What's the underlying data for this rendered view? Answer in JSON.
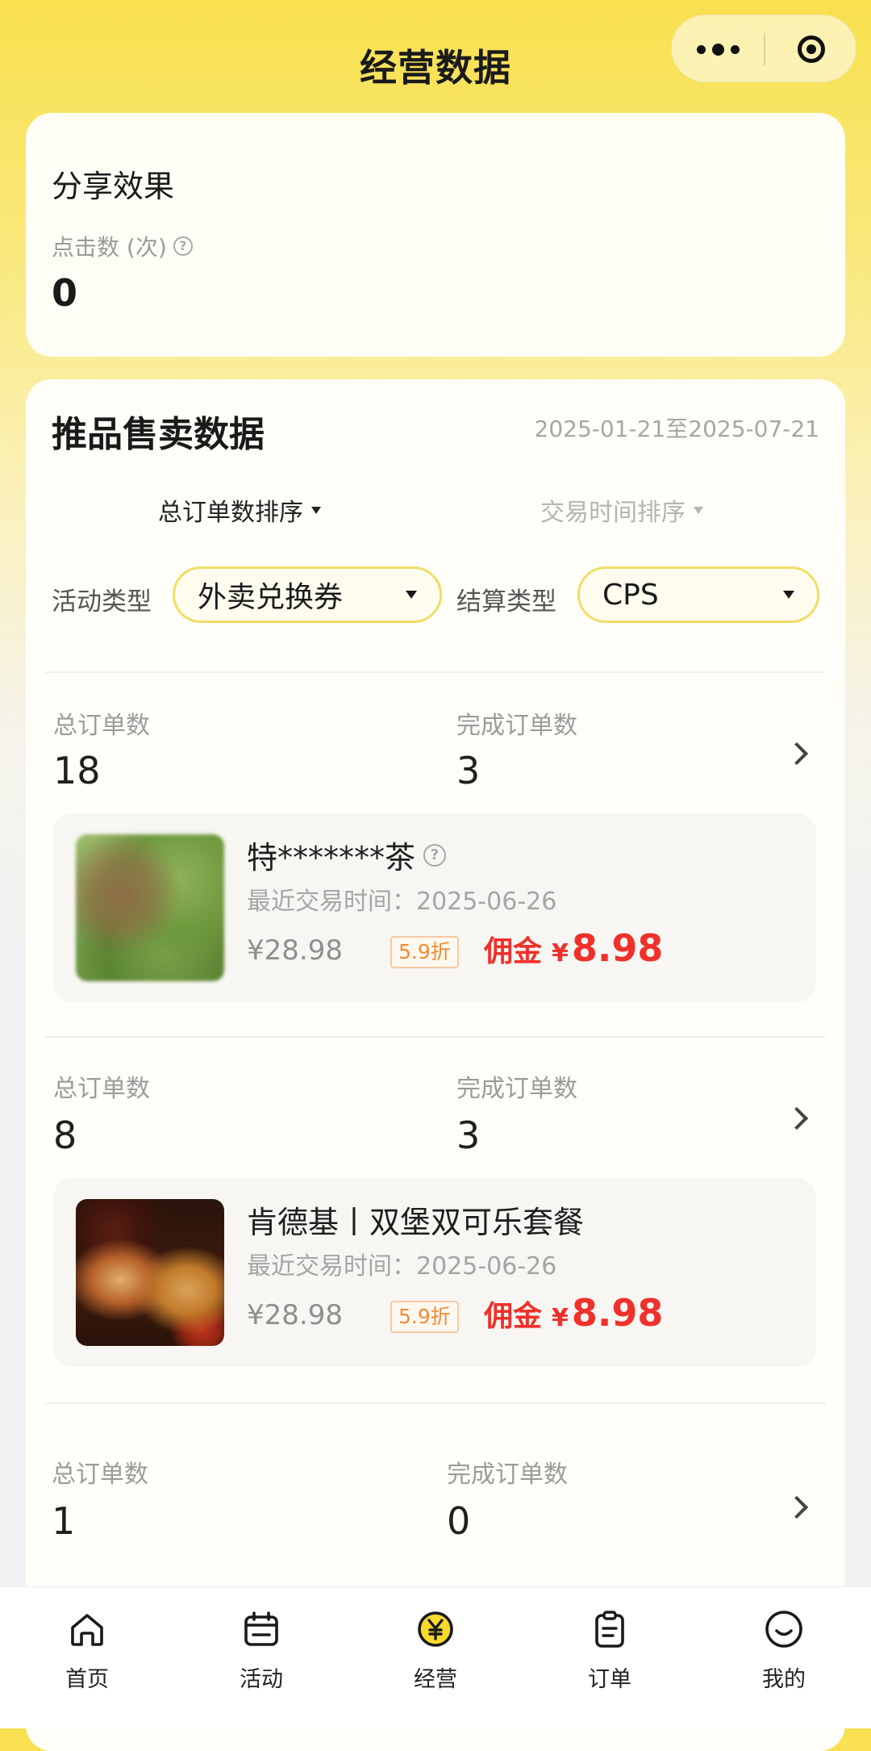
{
  "header": {
    "title": "经营数据"
  },
  "share": {
    "title": "分享效果",
    "click_label": "点击数 (次)",
    "click_value": "0"
  },
  "sales": {
    "title": "推品售卖数据",
    "date_range": "2025-01-21至2025-07-21",
    "sort_total": "总订单数排序",
    "sort_time": "交易时间排序",
    "activity_label": "活动类型",
    "activity_value": "外卖兑换券",
    "settle_label": "结算类型",
    "settle_value": "CPS"
  },
  "items": [
    {
      "total_label": "总订单数",
      "total": "18",
      "done_label": "完成订单数",
      "done": "3",
      "product": {
        "name": "特*******茶",
        "time": "最近交易时间：2025-06-26",
        "price": "¥28.98",
        "discount": "5.9折",
        "commission_label": "佣金",
        "commission_currency": "¥",
        "commission_amount": "8.98"
      }
    },
    {
      "total_label": "总订单数",
      "total": "8",
      "done_label": "完成订单数",
      "done": "3",
      "product": {
        "name": "肯德基丨双堡双可乐套餐",
        "time": "最近交易时间：2025-06-26",
        "price": "¥28.98",
        "discount": "5.9折",
        "commission_label": "佣金",
        "commission_currency": "¥",
        "commission_amount": "8.98"
      }
    },
    {
      "total_label": "总订单数",
      "total": "1",
      "done_label": "完成订单数",
      "done": "0"
    }
  ],
  "tabs": [
    {
      "label": "首页",
      "icon": "home-icon"
    },
    {
      "label": "活动",
      "icon": "calendar-icon"
    },
    {
      "label": "经营",
      "icon": "yuan-coin-icon"
    },
    {
      "label": "订单",
      "icon": "clipboard-icon"
    },
    {
      "label": "我的",
      "icon": "smiley-icon"
    }
  ],
  "colors": {
    "brand_yellow": "#f8e04e",
    "commission_red": "#f0302b",
    "discount_orange": "#f28b35"
  }
}
